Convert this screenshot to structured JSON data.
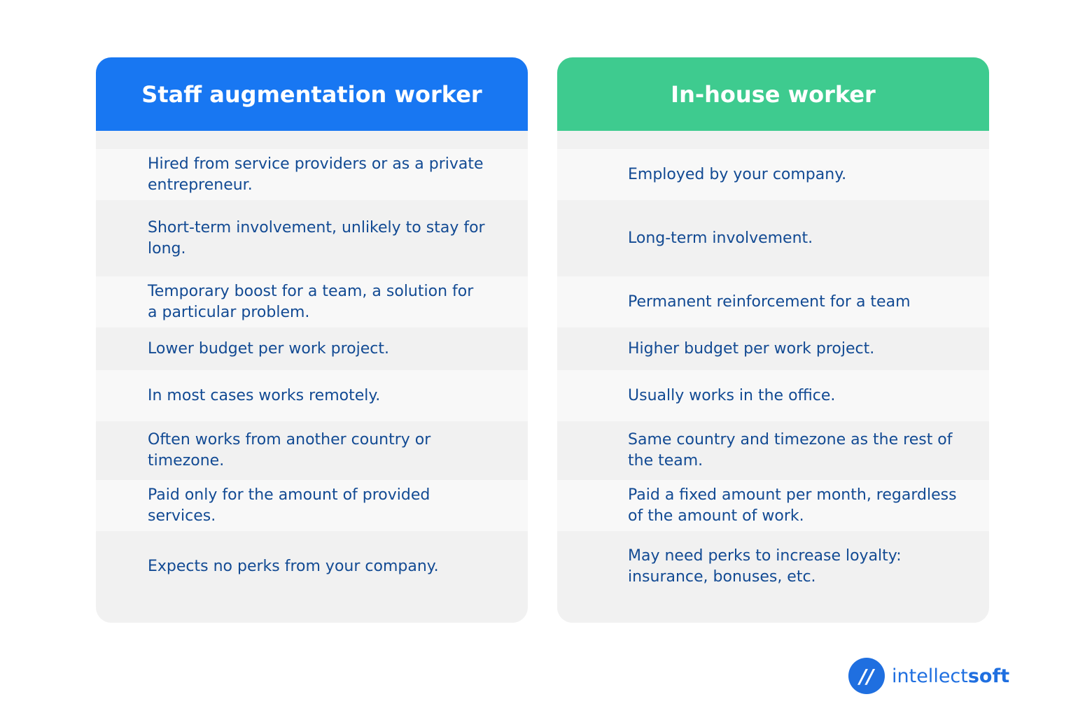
{
  "left": {
    "title": "Staff augmentation worker",
    "color": "#1877f2",
    "items": [
      "Hired from service providers or as a private entrepreneur.",
      "Short-term involvement, unlikely to stay for long.",
      "Temporary boost for a team, a solution for a particular problem.",
      "Lower budget per work project.",
      "In most cases works remotely.",
      "Often works from another country or timezone.",
      "Paid only for the amount of provided services.",
      "Expects no perks from your company."
    ]
  },
  "right": {
    "title": "In-house worker",
    "color": "#3ecb8f",
    "items": [
      "Employed by your company.",
      "Long-term involvement.",
      "Permanent reinforcement for a team",
      "Higher budget per work project.",
      "Usually works in the office.",
      "Same country and timezone as the rest of the team.",
      "Paid a fixed amount per month, regardless of the amount of work.",
      "May need perks to increase loyalty: insurance, bonuses, etc."
    ]
  },
  "logo": {
    "mark": "//",
    "text_regular": "intellect",
    "text_bold": "soft"
  }
}
